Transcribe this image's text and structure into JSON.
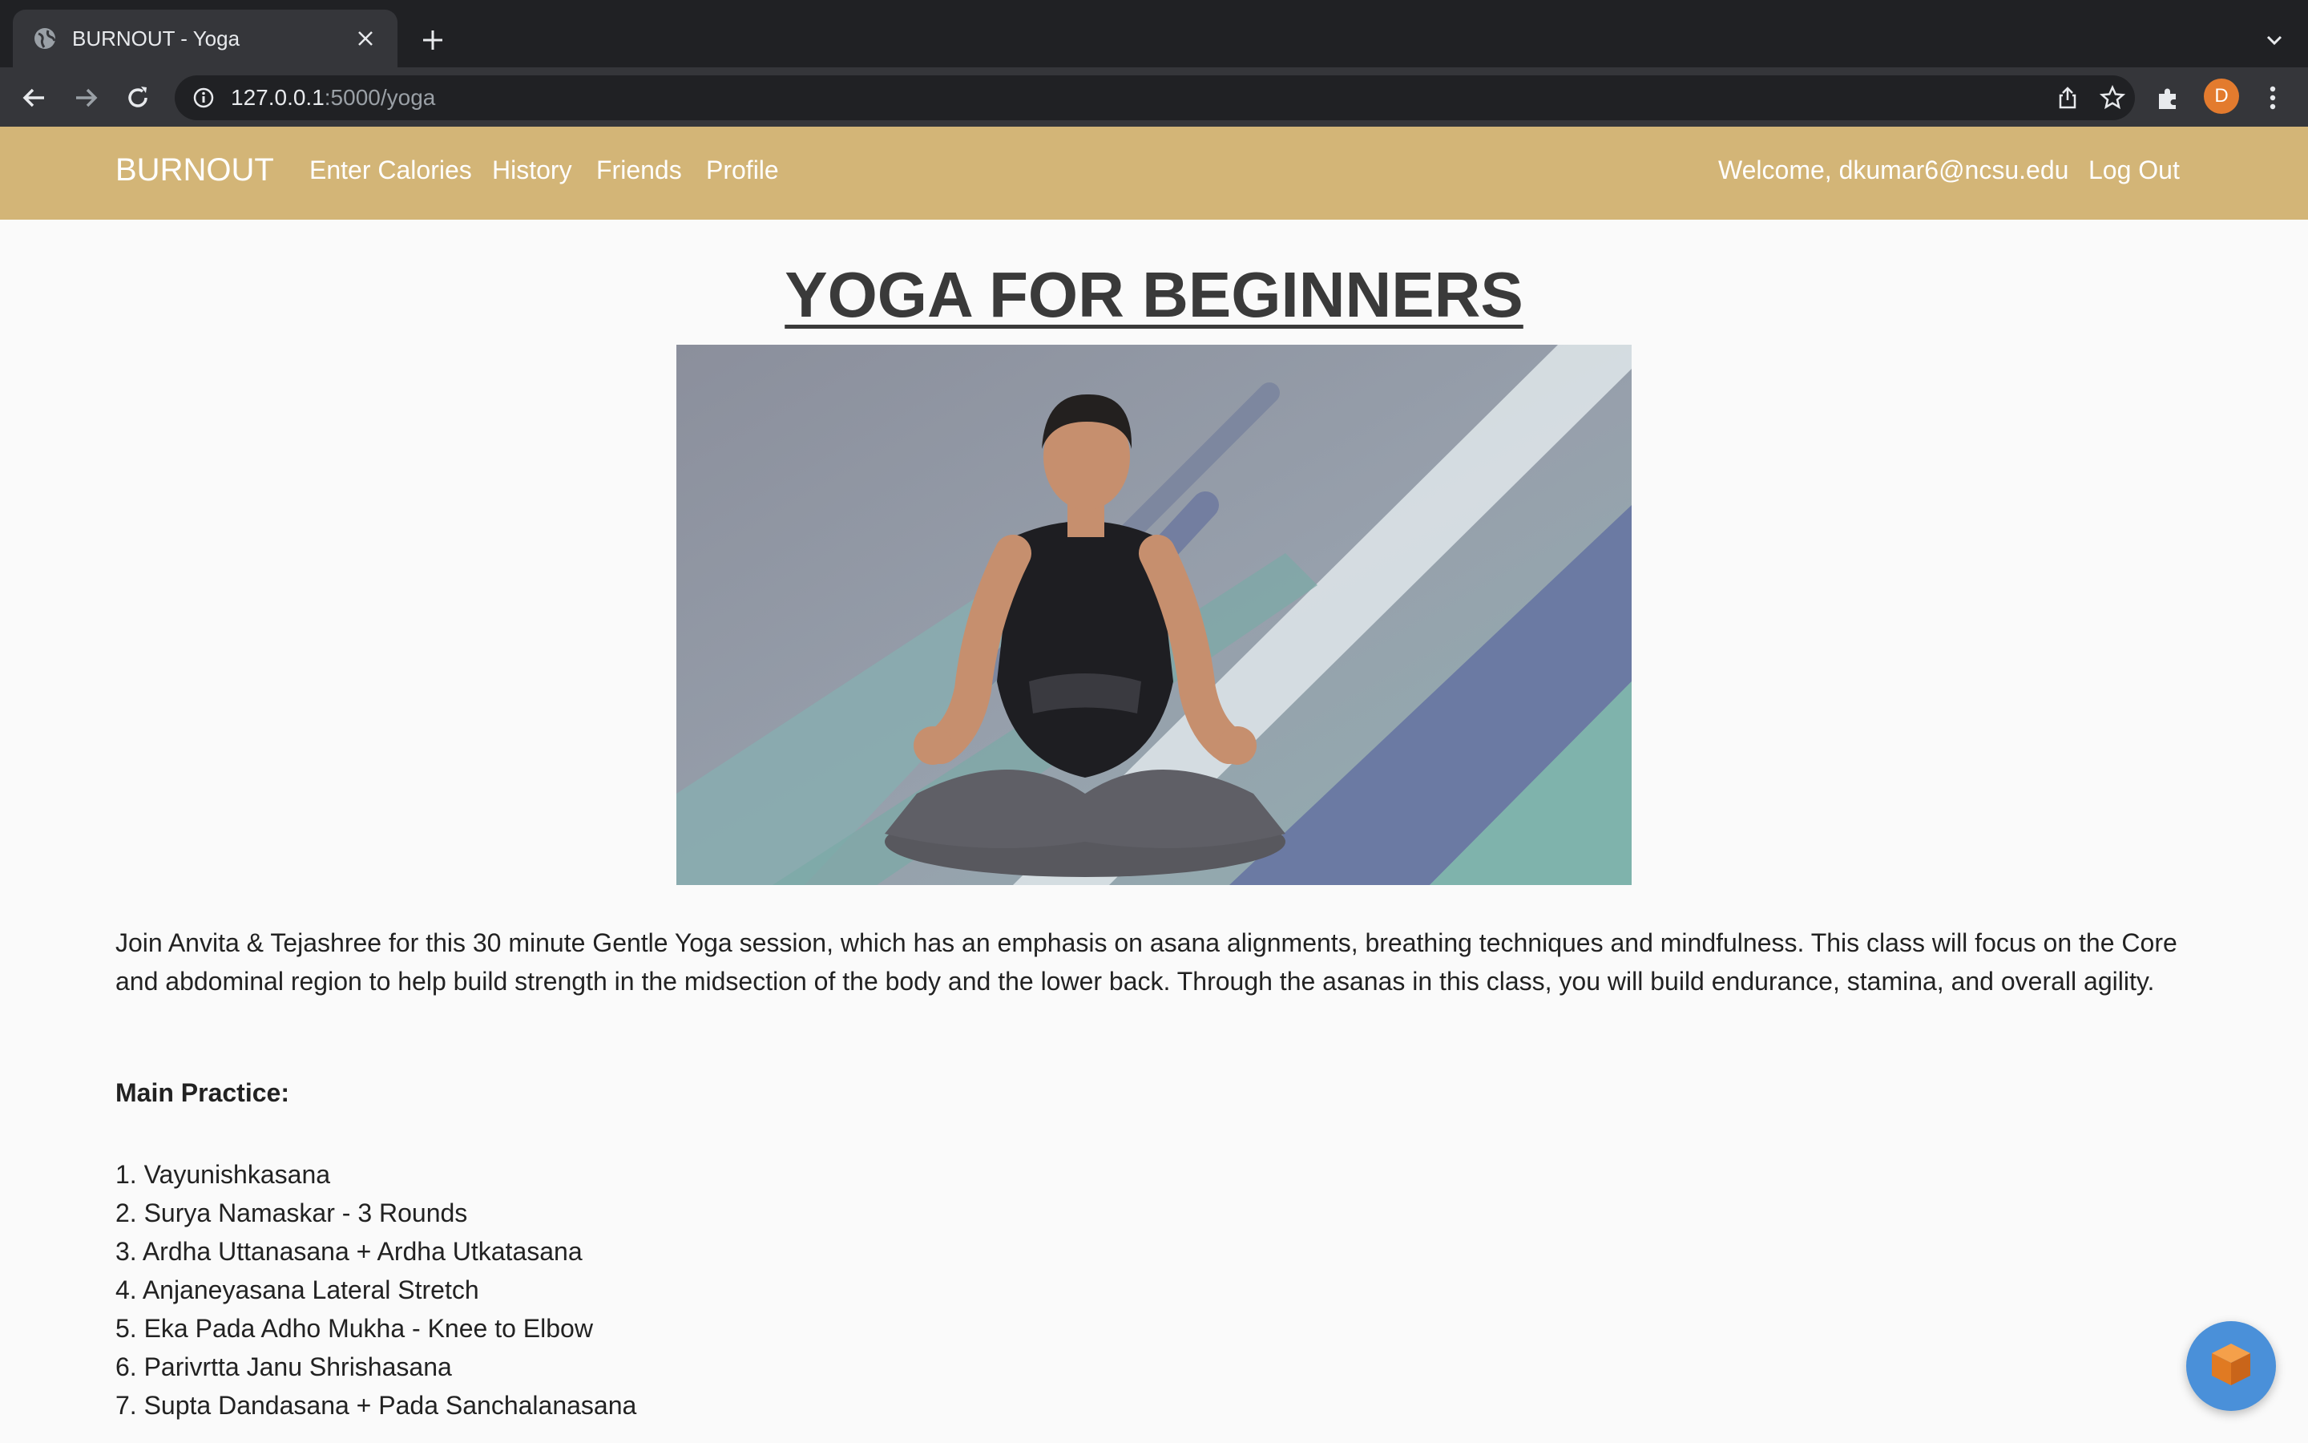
{
  "browser": {
    "tab_title": "BURNOUT - Yoga",
    "url_host": "127.0.0.1",
    "url_path": ":5000/yoga",
    "profile_initial": "D"
  },
  "navbar": {
    "brand": "BURNOUT",
    "links": [
      "Enter Calories",
      "History",
      "Friends",
      "Profile"
    ],
    "welcome": "Welcome, dkumar6@ncsu.edu",
    "logout": "Log Out"
  },
  "content": {
    "title": "YOGA FOR BEGINNERS",
    "description": "Join Anvita & Tejashree for this 30 minute Gentle Yoga session, which has an emphasis on asana alignments, breathing techniques and mindfulness. This class will focus on the Core and abdominal region to help build strength in the midsection of the body and the lower back. Through the asanas in this class, you will build endurance, stamina, and overall agility.",
    "section_heading": "Main Practice:",
    "practice": [
      "1. Vayunishkasana",
      "2. Surya Namaskar - 3 Rounds",
      "3. Ardha Uttanasana + Ardha Utkatasana",
      "4. Anjaneyasana Lateral Stretch",
      "5. Eka Pada Adho Mukha - Knee to Elbow",
      "6. Parivrtta Janu Shrishasana",
      "7. Supta Dandasana + Pada Sanchalanasana"
    ]
  },
  "colors": {
    "navbar": "#d3b577",
    "chrome_dark": "#202124",
    "chrome_mid": "#35363a",
    "avatar": "#e37b2e",
    "fab": "#4a90d9"
  },
  "icons": [
    "globe-icon",
    "close-icon",
    "plus-icon",
    "chevron-down-icon",
    "back-arrow-icon",
    "forward-arrow-icon",
    "reload-icon",
    "info-icon",
    "share-icon",
    "star-icon",
    "puzzle-icon",
    "kebab-menu-icon",
    "cube-icon"
  ]
}
